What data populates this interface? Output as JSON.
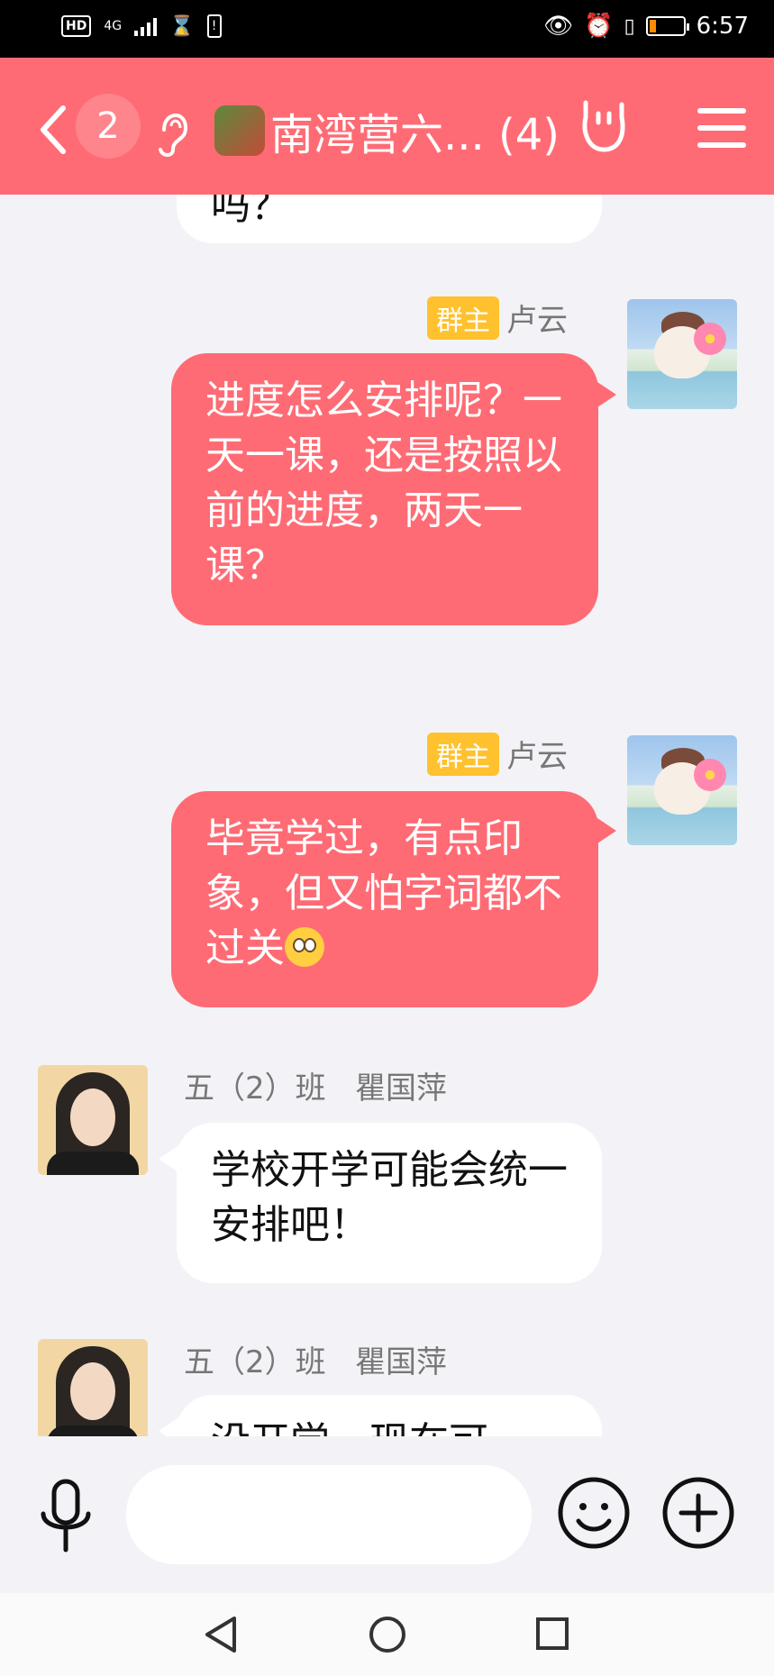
{
  "status_bar": {
    "hd": "HD",
    "network": "4G",
    "time": "6:57",
    "battery_percent": 20
  },
  "header": {
    "unread_count": "2",
    "title": "南湾营六... (4)",
    "icons": [
      "back-icon",
      "ear-icon",
      "dragon-avatar-icon",
      "hand-gesture-icon",
      "menu-icon"
    ]
  },
  "messages": {
    "partial_top": {
      "text": "吗？"
    },
    "m1": {
      "badge": "群主",
      "sender": "卢云",
      "text": "进度怎么安排呢？一天一课，还是按照以前的进度，两天一课？"
    },
    "m2": {
      "badge": "群主",
      "sender": "卢云",
      "text": "毕竟学过，有点印象，但又怕字词都不过关"
    },
    "m3": {
      "sender": "五（2）班   瞿国萍",
      "text": "学校开学可能会统一安排吧！"
    },
    "m4": {
      "sender": "五（2）班   瞿国萍",
      "text": "没开学，现在可"
    }
  },
  "input_bar": {
    "placeholder": ""
  },
  "colors": {
    "accent": "#ff6b74",
    "owner_badge": "#ffc12e",
    "background": "#f3f3f7"
  }
}
